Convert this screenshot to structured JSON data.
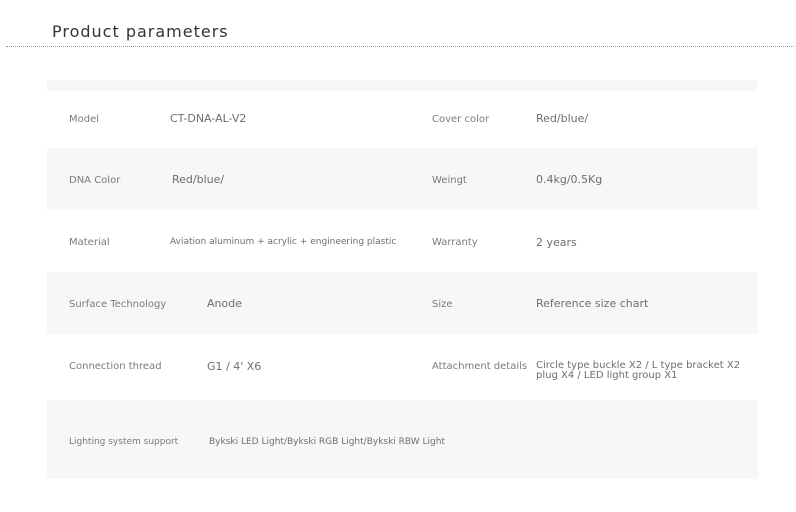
{
  "page": {
    "title": "Product parameters"
  },
  "specs": {
    "model_label": "Model",
    "model_value": "CT-DNA-AL-V2",
    "cover_color_label": "Cover color",
    "cover_color_value": "Red/blue/",
    "dna_color_label": "DNA Color",
    "dna_color_value": "Red/blue/",
    "weight_label": "Weingt",
    "weight_value": "0.4kg/0.5Kg",
    "material_label": "Material",
    "material_value": "Aviation aluminum + acrylic + engineering plastic",
    "warranty_label": "Warranty",
    "warranty_value": "2 years",
    "surface_label": "Surface Technology",
    "surface_value": "Anode",
    "size_label": "Size",
    "size_value": "Reference size chart",
    "thread_label": "Connection thread",
    "thread_value": "G1 / 4' X6",
    "attachment_label": "Attachment details",
    "attachment_value": "Circle type buckle X2 / L type bracket X2 plug X4 / LED light group X1",
    "lighting_label": "Lighting system support",
    "lighting_value": "Bykski LED Light/Bykski RGB Light/Bykski RBW Light"
  }
}
